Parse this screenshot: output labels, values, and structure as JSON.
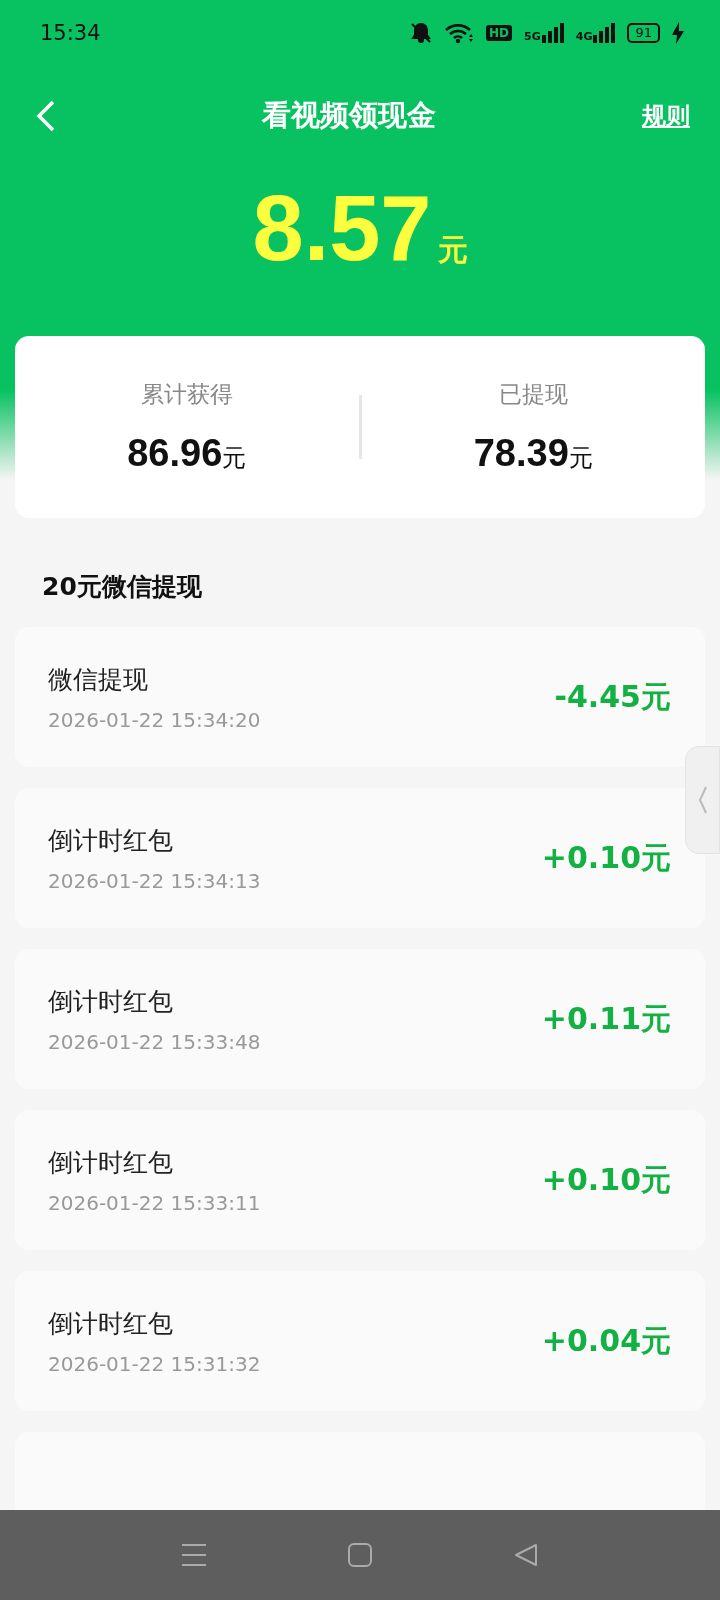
{
  "status_bar": {
    "time": "15:34",
    "hd_label": "HD",
    "net_1": "5G",
    "net_2": "4G",
    "battery": "91"
  },
  "header": {
    "title": "看视频领现金",
    "rules_link": "规则"
  },
  "balance": {
    "amount": "8.57",
    "unit": "元"
  },
  "summary": [
    {
      "label": "累计获得",
      "value": "86.96",
      "unit": "元"
    },
    {
      "label": "已提现",
      "value": "78.39",
      "unit": "元"
    }
  ],
  "section_title": "20元微信提现",
  "records": [
    {
      "title": "微信提现",
      "time": "2026-01-22 15:34:20",
      "amount": "-4.45元"
    },
    {
      "title": "倒计时红包",
      "time": "2026-01-22 15:34:13",
      "amount": "+0.10元"
    },
    {
      "title": "倒计时红包",
      "time": "2026-01-22 15:33:48",
      "amount": "+0.11元"
    },
    {
      "title": "倒计时红包",
      "time": "2026-01-22 15:33:11",
      "amount": "+0.10元"
    },
    {
      "title": "倒计时红包",
      "time": "2026-01-22 15:31:32",
      "amount": "+0.04元"
    }
  ]
}
